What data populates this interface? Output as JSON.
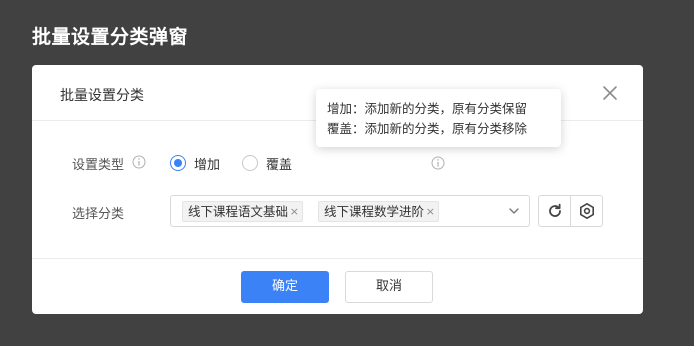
{
  "page": {
    "title": "批量设置分类弹窗"
  },
  "dialog": {
    "title": "批量设置分类",
    "close_icon": "close-icon",
    "tooltip": {
      "line1": "增加：添加新的分类，原有分类保留",
      "line2": "覆盖：添加新的分类，原有分类移除"
    },
    "type_row": {
      "label": "设置类型",
      "options": [
        {
          "label": "增加",
          "checked": true
        },
        {
          "label": "覆盖",
          "checked": false
        }
      ]
    },
    "category_row": {
      "label": "选择分类",
      "tags": [
        "线下课程语文基础",
        "线下课程数学进阶"
      ],
      "tag_remove": "×"
    },
    "icons": {
      "refresh": "refresh-icon",
      "settings": "settings-icon",
      "info": "info-icon",
      "chevron": "chevron-down-icon"
    },
    "footer": {
      "confirm_label": "确定",
      "cancel_label": "取消"
    },
    "colors": {
      "overlay": "#414141",
      "primary": "#3b82f6"
    }
  }
}
